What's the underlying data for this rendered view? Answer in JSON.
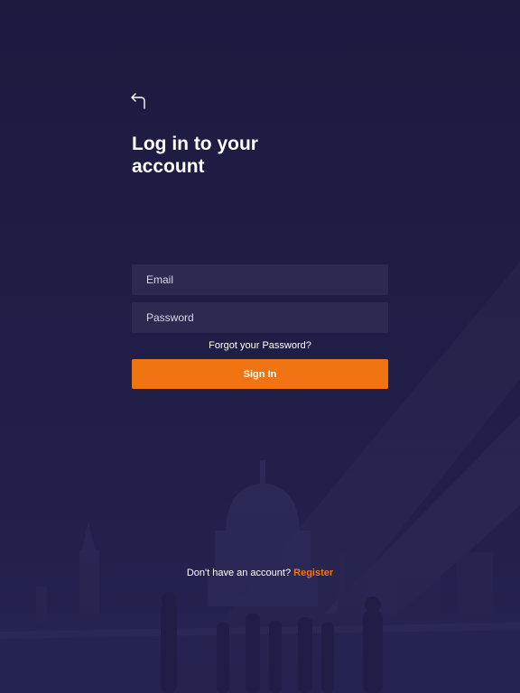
{
  "colors": {
    "background": "#1c1b3e",
    "field_background": "#2d2a52",
    "accent": "#f07512",
    "text": "#ffffff"
  },
  "header": {
    "back_icon": "back-arrow-icon",
    "title_line1": "Log in to your",
    "title_line2": "account"
  },
  "form": {
    "email_placeholder": "Email",
    "password_placeholder": "Password",
    "forgot_label": "Forgot your Password?",
    "signin_label": "Sign In"
  },
  "footer": {
    "prompt": "Don't have an account?",
    "register_label": "Register"
  },
  "background_image": "city-crowd-silhouette"
}
